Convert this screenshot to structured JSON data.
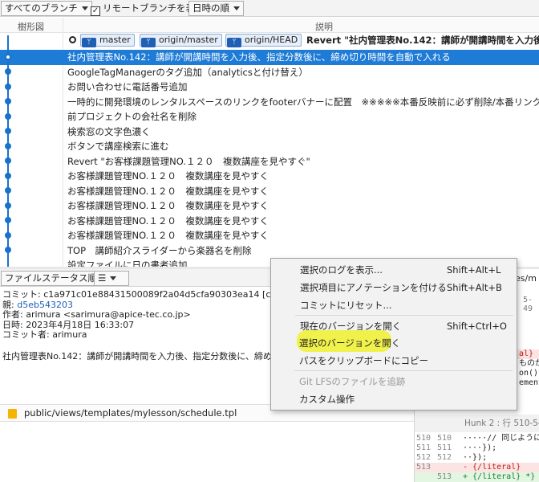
{
  "toolbar": {
    "branch_filter": "すべてのブランチ",
    "remote_checkbox_label": "リモートブランチを表示",
    "remote_checked": true,
    "sort_order": "日時の順"
  },
  "columns": {
    "graph": "樹形図",
    "description": "説明"
  },
  "branch_row": {
    "tags": [
      "master",
      "origin/master",
      "origin/HEAD"
    ],
    "message": "Revert \"社内管理表No.142：講師が開講時間を入力後、指"
  },
  "commits": [
    "社内管理表No.142：講師が開講時間を入力後、指定分数後に、締め切り時間を自動で入れる",
    "GoogleTagManagerのタグ追加（analyticsと付け替え）",
    "お問い合わせに電話番号追加",
    "一時的に開発環境のレンタルスペースのリンクをfooterバナーに配置　※※※※※本番反映前に必ず削除/本番リンクに差し替え",
    "前プロジェクトの会社名を削除",
    "検索窓の文字色濃く",
    "ボタンで講座検索に進む",
    "Revert \"お客様課題管理NO.１２０　複数講座を見やすぐ\"",
    "お客様課題管理NO.１２０　複数講座を見やすく",
    "お客様課題管理NO.１２０　複数講座を見やすく",
    "お客様課題管理NO.１２０　複数講座を見やすく",
    "お客様課題管理NO.１２０　複数講座を見やすく",
    "お客様課題管理NO.１２０　複数講座を見やすく",
    "TOP　講師紹介スライダーから楽器名を削除",
    "設定ファイルに日の書者追加"
  ],
  "selected_commit_index": 0,
  "file_toolbar": {
    "sort": "ファイルステータス順",
    "view_icon": "list-icon"
  },
  "details": {
    "commit_label": "コミット:",
    "commit_hash": "c1a971c01e88431500089f2a04d5cfa90303ea14 [c1a9",
    "parent_label": "親:",
    "parent_hash": "d5eb543203",
    "author_label": "作者:",
    "author": "arimura <sarimura@apice-tec.co.jp>",
    "date_label": "日時:",
    "date": "2023年4月18日 16:33:07",
    "committer_label": "コミット者:",
    "committer": "arimura",
    "summary": "社内管理表No.142：講師が開講時間を入力後、指定分数後に、締め切り"
  },
  "file": {
    "path": "public/views/templates/mylesson/schedule.tpl",
    "icon": "modified-file-icon"
  },
  "diff": {
    "tab_fragment": "es/m",
    "hash_fragment": "5-49",
    "lines_top": [
      {
        "ln1": "",
        "ln2": "",
        "code": "al}",
        "kind": "del"
      },
      {
        "ln1": "",
        "ln2": "",
        "code": "ものが入",
        "kind": "ctx"
      },
      {
        "ln1": "",
        "ln2": "",
        "code": "on(){",
        "kind": "ctx"
      },
      {
        "ln1": "",
        "ln2": "",
        "code": "ement",
        "kind": "ctx"
      }
    ],
    "hunk": "Hunk 2 : 行 510-543",
    "lines_bottom": [
      {
        "ln1": "510",
        "ln2": "510",
        "code": "·····// 同じように",
        "kind": "ctx"
      },
      {
        "ln1": "511",
        "ln2": "511",
        "code": "····});",
        "kind": "ctx"
      },
      {
        "ln1": "512",
        "ln2": "512",
        "code": "··});",
        "kind": "ctx"
      },
      {
        "ln1": "513",
        "ln2": "",
        "code": "- {/literal}",
        "kind": "del"
      },
      {
        "ln1": "",
        "ln2": "513",
        "code": "+ {/literal} *}",
        "kind": "add"
      }
    ]
  },
  "context_menu": {
    "items": [
      {
        "label": "選択のログを表示...",
        "shortcut": "Shift+Alt+L",
        "enabled": true
      },
      {
        "label": "選択項目にアノテーションを付ける",
        "shortcut": "Shift+Alt+B",
        "enabled": true
      },
      {
        "label": "コミットにリセット...",
        "shortcut": "",
        "enabled": true
      },
      {
        "label": "現在のバージョンを開く",
        "shortcut": "Shift+Ctrl+O",
        "enabled": true
      },
      {
        "label": "選択のバージョンを開く",
        "shortcut": "",
        "enabled": true
      },
      {
        "label": "パスをクリップボードにコピー",
        "shortcut": "",
        "enabled": true
      },
      {
        "label": "Git LFSのファイルを追跡",
        "shortcut": "",
        "enabled": false
      },
      {
        "label": "カスタム操作",
        "shortcut": "",
        "enabled": true
      }
    ],
    "highlighted_item_index": 4,
    "highlight_color": "#f0f014"
  },
  "colors": {
    "selection": "#1e7bd6",
    "graph": "#1873c8",
    "link": "#1a5fb4"
  }
}
